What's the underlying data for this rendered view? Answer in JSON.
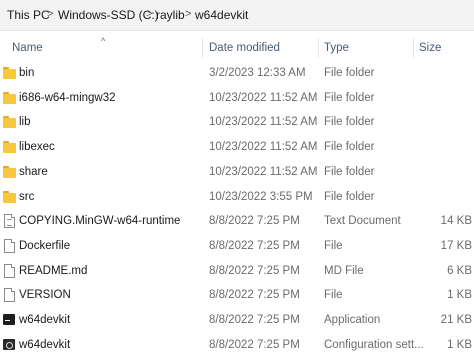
{
  "breadcrumb": [
    "This PC",
    "Windows-SSD (C:)",
    "raylib",
    "w64devkit"
  ],
  "columns": {
    "name": "Name",
    "date": "Date modified",
    "type": "Type",
    "size": "Size"
  },
  "files": [
    {
      "name": "bin",
      "date": "3/2/2023 12:33 AM",
      "type": "File folder",
      "size": "",
      "icon": "folder-icon"
    },
    {
      "name": "i686-w64-mingw32",
      "date": "10/23/2022 11:52 AM",
      "type": "File folder",
      "size": "",
      "icon": "folder-icon"
    },
    {
      "name": "lib",
      "date": "10/23/2022 11:52 AM",
      "type": "File folder",
      "size": "",
      "icon": "folder-icon"
    },
    {
      "name": "libexec",
      "date": "10/23/2022 11:52 AM",
      "type": "File folder",
      "size": "",
      "icon": "folder-icon"
    },
    {
      "name": "share",
      "date": "10/23/2022 11:52 AM",
      "type": "File folder",
      "size": "",
      "icon": "folder-icon"
    },
    {
      "name": "src",
      "date": "10/23/2022 3:55 PM",
      "type": "File folder",
      "size": "",
      "icon": "folder-icon"
    },
    {
      "name": "COPYING.MinGW-w64-runtime",
      "date": "8/8/2022 7:25 PM",
      "type": "Text Document",
      "size": "14 KB",
      "icon": "text-file-icon"
    },
    {
      "name": "Dockerfile",
      "date": "8/8/2022 7:25 PM",
      "type": "File",
      "size": "17 KB",
      "icon": "file-icon"
    },
    {
      "name": "README.md",
      "date": "8/8/2022 7:25 PM",
      "type": "MD File",
      "size": "6 KB",
      "icon": "file-icon"
    },
    {
      "name": "VERSION",
      "date": "8/8/2022 7:25 PM",
      "type": "File",
      "size": "1 KB",
      "icon": "file-icon"
    },
    {
      "name": "w64devkit",
      "date": "8/8/2022 7:25 PM",
      "type": "Application",
      "size": "21 KB",
      "icon": "application-icon"
    },
    {
      "name": "w64devkit",
      "date": "8/8/2022 7:25 PM",
      "type": "Configuration sett...",
      "size": "1 KB",
      "icon": "configuration-icon"
    }
  ]
}
